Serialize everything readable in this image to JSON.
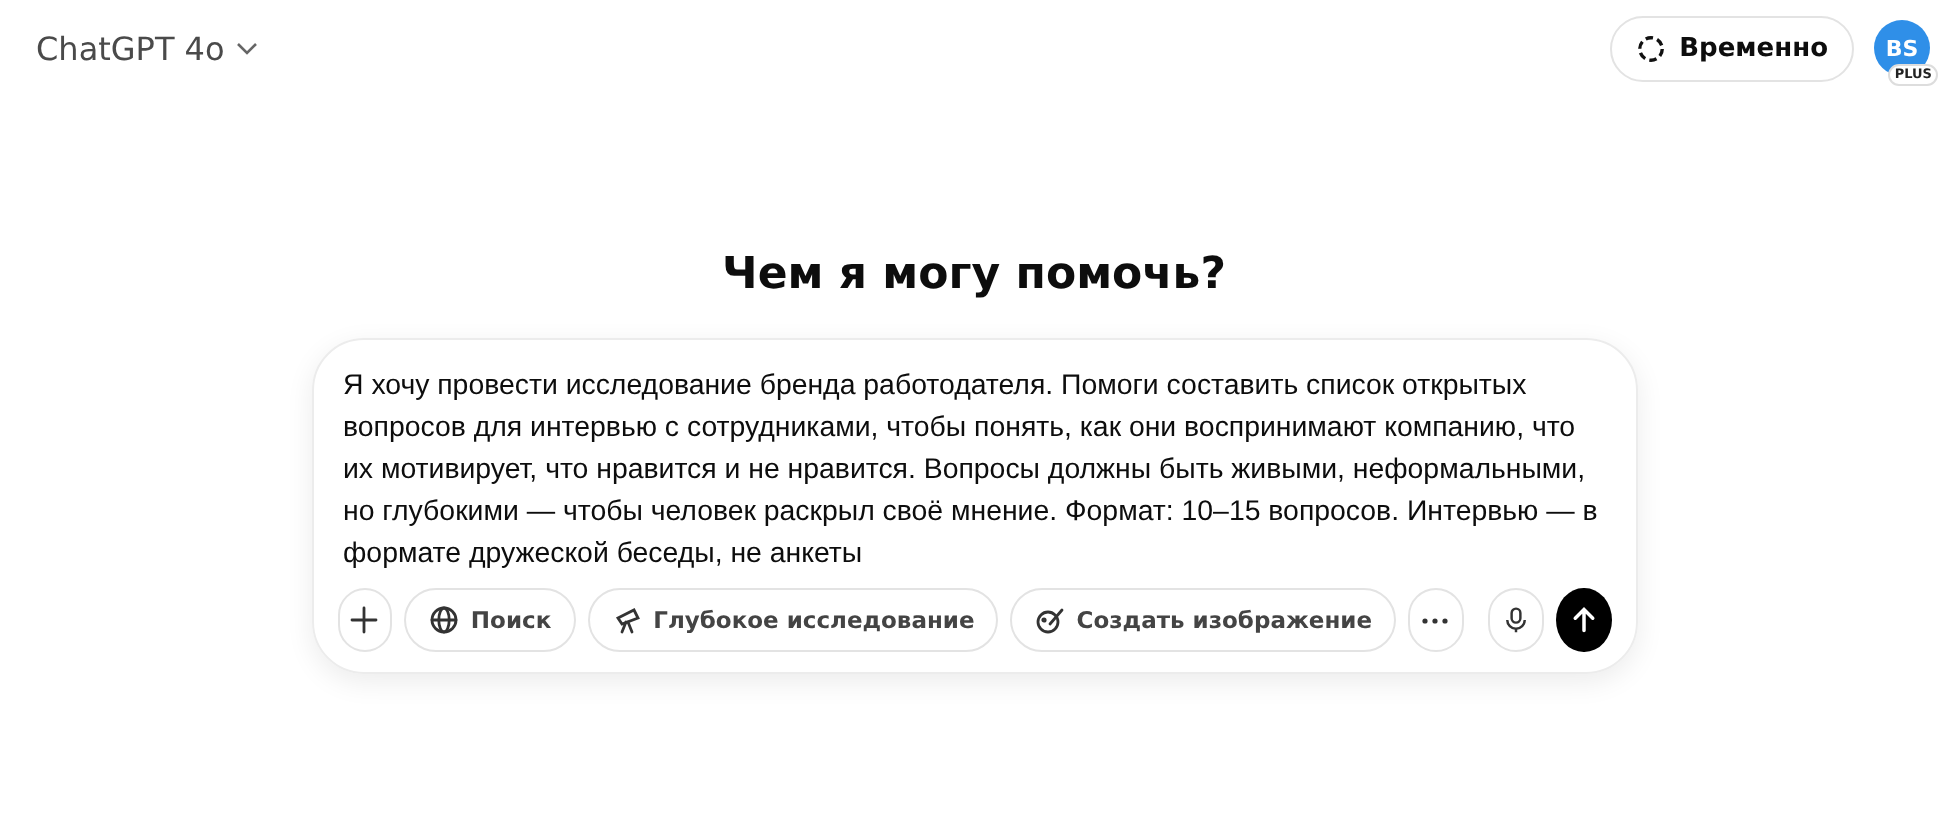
{
  "header": {
    "model": "ChatGPT 4o",
    "temporary_button": "Временно",
    "avatar": {
      "initials": "BS",
      "badge": "PLUS"
    }
  },
  "heading": "Чем я могу помочь?",
  "composer": {
    "value": "Я хочу провести исследование бренда работодателя. Помоги составить список открытых вопросов для интервью с сотрудниками, чтобы понять, как они воспринимают компанию, что их мотивирует, что нравится и не нравится. Вопросы должны быть живыми, неформальными, но глубокими — чтобы человек раскрыл своё мнение. Формат: 10–15 вопросов. Интервью — в формате дружеской беседы, не анкеты",
    "tools": [
      {
        "kind": "plus"
      },
      {
        "kind": "globe",
        "label": "Поиск"
      },
      {
        "kind": "telescope",
        "label": "Глубокое исследование"
      },
      {
        "kind": "brush",
        "label": "Создать изображение"
      },
      {
        "kind": "more"
      }
    ]
  }
}
